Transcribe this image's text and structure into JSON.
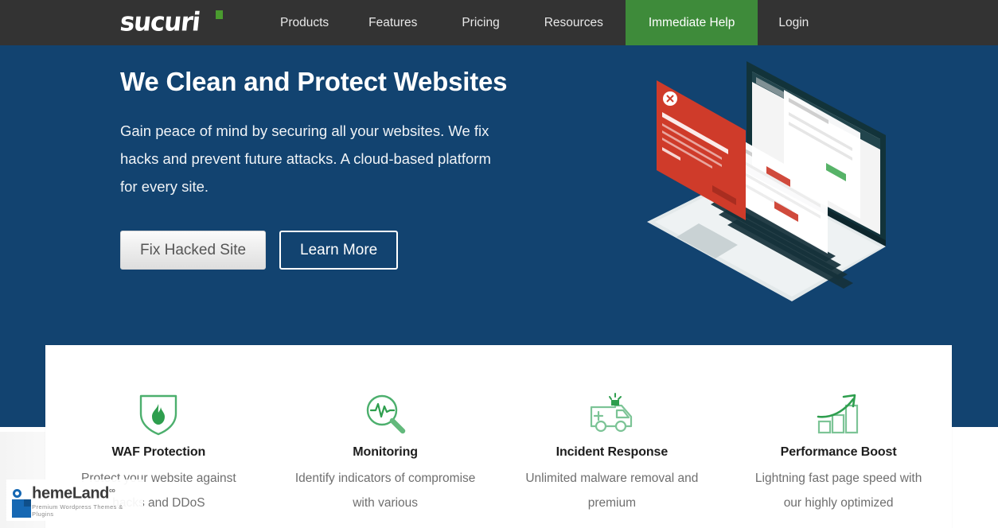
{
  "navbar": {
    "logo": {
      "text": "sucuri",
      "name": "sucuri-logo"
    },
    "links": [
      {
        "label": "Products",
        "name": "nav-link-products"
      },
      {
        "label": "Features",
        "name": "nav-link-features"
      },
      {
        "label": "Pricing",
        "name": "nav-link-pricing"
      },
      {
        "label": "Resources",
        "name": "nav-link-resources"
      }
    ],
    "cta": {
      "label": "Immediate Help",
      "color": "#3e8b3a"
    },
    "login": {
      "label": "Login"
    },
    "background_color": "#333333"
  },
  "hero": {
    "title": "We Clean and Protect Websites",
    "subtitle": "Gain peace of mind by securing all your websites. We fix hacks and prevent future attacks. A cloud-based platform for every site.",
    "primary_button": "Fix Hacked Site",
    "secondary_button": "Learn More",
    "background_color": "#124370",
    "illustration": "isometric-laptop-with-dashboard-windows"
  },
  "features": [
    {
      "icon": "shield-flame-icon",
      "title": "WAF Protection",
      "description": "Protect your website against hacks and DDoS"
    },
    {
      "icon": "magnifier-pulse-icon",
      "title": "Monitoring",
      "description": "Identify indicators of compromise with various"
    },
    {
      "icon": "ambulance-icon",
      "title": "Incident Response",
      "description": "Unlimited malware removal and premium"
    },
    {
      "icon": "growth-chart-icon",
      "title": "Performance Boost",
      "description": "Lightning fast page speed with our highly optimized"
    }
  ],
  "watermark": {
    "brand_prefix": "i",
    "brand_main": "hemeLand",
    "trademark": "co",
    "tagline": "Premium Wordpress Themes & Plugins"
  },
  "colors": {
    "navy": "#124370",
    "green": "#3e8b3a",
    "icon_green": "#4caf6d",
    "charcoal": "#333333"
  }
}
